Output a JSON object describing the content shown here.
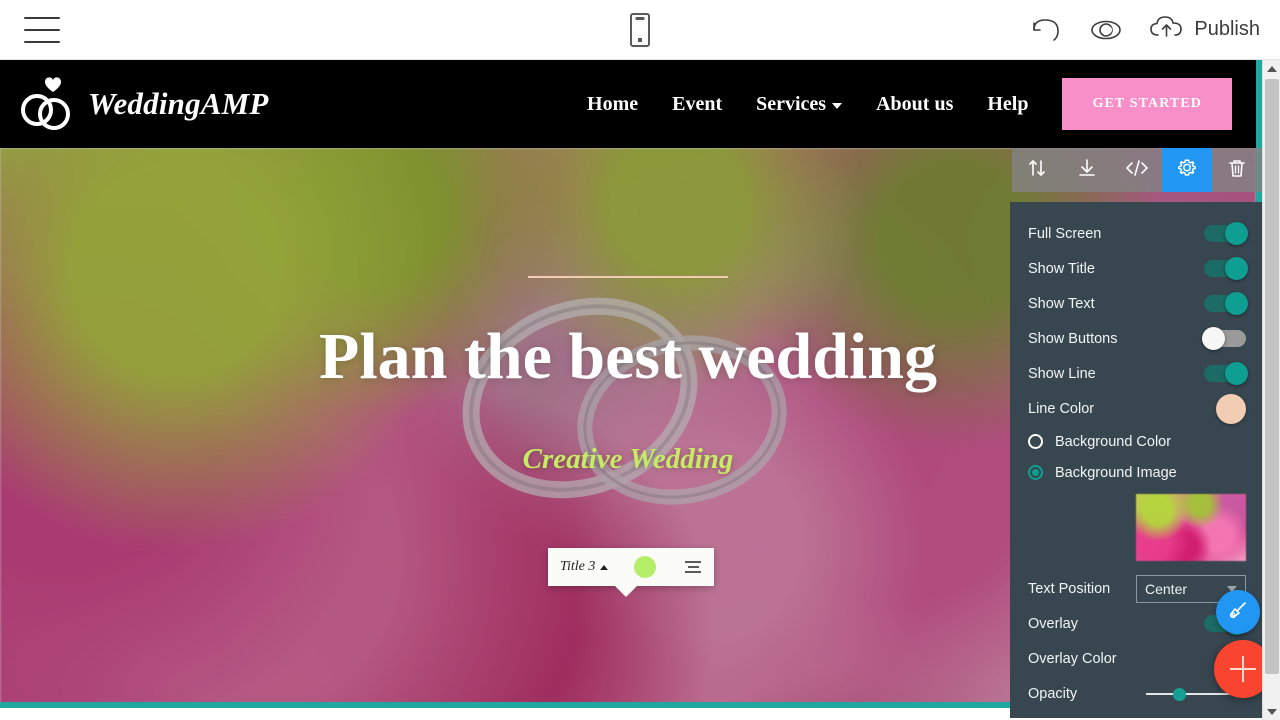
{
  "app": {
    "topbar": {
      "menu_icon": "hamburger-menu-icon",
      "device_icon": "mobile-device-icon",
      "undo_icon": "undo-icon",
      "preview_icon": "eye-preview-icon",
      "publish_icon": "cloud-upload-icon",
      "publish_label": "Publish"
    }
  },
  "site": {
    "brand": {
      "name": "WeddingAMP",
      "logo_icon": "wedding-rings-heart-logo"
    },
    "nav": [
      {
        "label": "Home",
        "has_dropdown": false
      },
      {
        "label": "Event",
        "has_dropdown": false
      },
      {
        "label": "Services",
        "has_dropdown": true
      },
      {
        "label": "About us",
        "has_dropdown": false
      },
      {
        "label": "Help",
        "has_dropdown": false
      }
    ],
    "cta": {
      "label": "GET STARTED",
      "color": "#f98fc8"
    },
    "hero": {
      "title": "Plan the best wedding",
      "subtitle": "Creative Wedding",
      "subtitle_color": "#c7ec63",
      "line_color": "#f2cdb4"
    }
  },
  "text_editor_popover": {
    "style_label": "Title 3",
    "caret_icon": "chevron-up-icon",
    "color_swatch": "#b5ef6a",
    "align_icon": "align-center-icon"
  },
  "block_toolbar": {
    "items": [
      {
        "name": "move-block",
        "icon": "arrows-up-down-icon",
        "active": false
      },
      {
        "name": "download-block",
        "icon": "download-icon",
        "active": false
      },
      {
        "name": "edit-code",
        "icon": "code-brackets-icon",
        "active": false
      },
      {
        "name": "block-settings",
        "icon": "gear-icon",
        "active": true
      },
      {
        "name": "delete-block",
        "icon": "trash-icon",
        "active": false
      }
    ],
    "active_color": "#2196f3"
  },
  "settings_panel": {
    "toggles": [
      {
        "label": "Full Screen",
        "state": "on"
      },
      {
        "label": "Show Title",
        "state": "on"
      },
      {
        "label": "Show Text",
        "state": "on"
      },
      {
        "label": "Show Buttons",
        "state": "off"
      },
      {
        "label": "Show Line",
        "state": "on"
      }
    ],
    "line_color": {
      "label": "Line Color",
      "value": "#f2cdb4"
    },
    "background": {
      "options": [
        {
          "label": "Background Color",
          "selected": false
        },
        {
          "label": "Background Image",
          "selected": true
        }
      ],
      "thumbnail_alt": "flower-bouquet-thumbnail"
    },
    "text_position": {
      "label": "Text Position",
      "value": "Center"
    },
    "overlay": {
      "label": "Overlay",
      "state": "on"
    },
    "overlay_color": {
      "label": "Overlay Color",
      "value": "#4a4240"
    },
    "opacity": {
      "label": "Opacity",
      "value": 30
    }
  },
  "fabs": {
    "brush": {
      "icon": "paint-brush-icon",
      "color": "#2196f3"
    },
    "add": {
      "icon": "plus-icon",
      "color": "#f9452f"
    }
  },
  "scrollbar": {
    "up_icon": "scroll-up-arrow-icon",
    "down_icon": "scroll-down-arrow-icon"
  }
}
